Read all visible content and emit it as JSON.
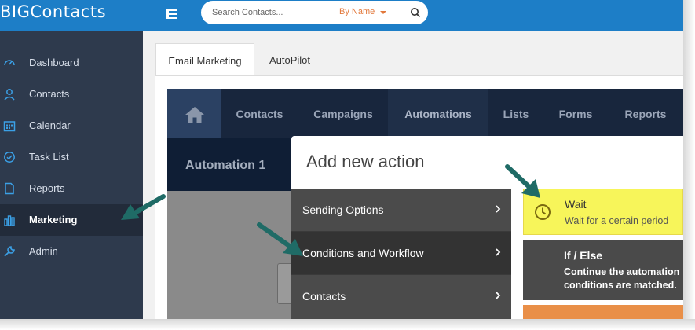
{
  "app": {
    "logo": "BIGContacts"
  },
  "search": {
    "placeholder": "Search Contacts...",
    "mode": "By Name"
  },
  "sidebar": {
    "items": [
      {
        "label": "Dashboard",
        "icon": "speedometer-icon"
      },
      {
        "label": "Contacts",
        "icon": "user-icon"
      },
      {
        "label": "Calendar",
        "icon": "calendar-icon"
      },
      {
        "label": "Task List",
        "icon": "check-circle-icon"
      },
      {
        "label": "Reports",
        "icon": "document-icon"
      },
      {
        "label": "Marketing",
        "icon": "bar-chart-icon",
        "active": true
      },
      {
        "label": "Admin",
        "icon": "wrench-icon"
      }
    ]
  },
  "tabs": [
    {
      "label": "Email Marketing",
      "active": true
    },
    {
      "label": "AutoPilot"
    }
  ],
  "app_nav": {
    "items": [
      "Contacts",
      "Campaigns",
      "Automations",
      "Lists",
      "Forms",
      "Reports"
    ],
    "current": "Automations"
  },
  "automation": {
    "title": "Automation 1"
  },
  "modal": {
    "title": "Add new action",
    "categories": [
      {
        "label": "Sending Options"
      },
      {
        "label": "Conditions and Workflow",
        "selected": true
      },
      {
        "label": "Contacts"
      }
    ],
    "actions": [
      {
        "title": "Wait",
        "description": "Wait for a certain period"
      },
      {
        "title": "If / Else",
        "description": "Continue the automation conditions are matched."
      }
    ]
  },
  "colors": {
    "topbar": "#1d7ec7",
    "sidebar": "#2e3a4d",
    "wait_card": "#f7f55a",
    "accent_orange": "#e2783b",
    "annotation_arrow": "#1f6b66"
  }
}
